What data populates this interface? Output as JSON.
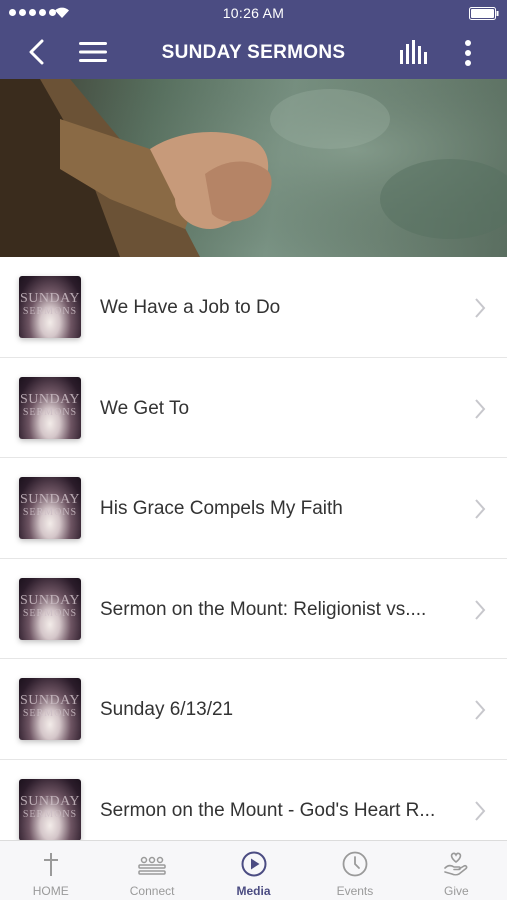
{
  "status_bar": {
    "time": "10:26 AM"
  },
  "header": {
    "title": "SUNDAY SERMONS"
  },
  "thumbnail_text": {
    "line1": "SUNDAY",
    "line2": "SERMONS"
  },
  "sermons": [
    {
      "title": "We Have a Job to Do"
    },
    {
      "title": "We Get To"
    },
    {
      "title": "His Grace Compels My Faith"
    },
    {
      "title": "Sermon on the Mount: Religionist vs...."
    },
    {
      "title": "Sunday 6/13/21"
    },
    {
      "title": "Sermon on the Mount - God's Heart R..."
    }
  ],
  "tabs": [
    {
      "label": "HOME",
      "icon": "cross-icon",
      "active": false
    },
    {
      "label": "Connect",
      "icon": "people-icon",
      "active": false
    },
    {
      "label": "Media",
      "icon": "play-icon",
      "active": true
    },
    {
      "label": "Events",
      "icon": "clock-icon",
      "active": false
    },
    {
      "label": "Give",
      "icon": "give-hand-icon",
      "active": false
    }
  ],
  "colors": {
    "header_bg": "#4b4c82",
    "accent": "#4b4c82",
    "tab_inactive": "#9a9a9a",
    "text": "#333333"
  }
}
